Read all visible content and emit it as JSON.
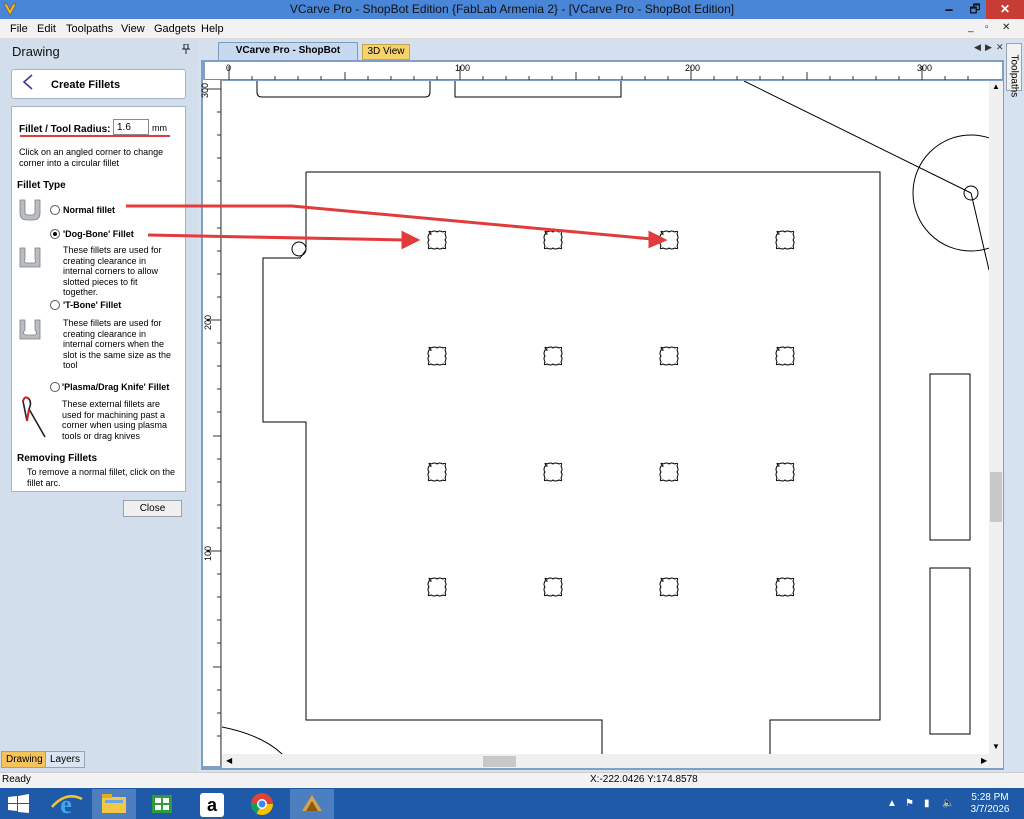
{
  "window": {
    "title": "VCarve Pro - ShopBot Edition {FabLab Armenia 2} - [VCarve Pro - ShopBot Edition]",
    "min_label": "🗕",
    "max_label": "🗗",
    "close_label": "✕"
  },
  "menu": {
    "items": [
      "File",
      "Edit",
      "Toolpaths",
      "View",
      "Gadgets",
      "Help"
    ],
    "mdi_controls": [
      "_",
      "▫",
      "✕"
    ]
  },
  "panel": {
    "title": "Drawing",
    "pin": "ᵖ",
    "form_title": "Create Fillets",
    "radius_label": "Fillet / Tool Radius:",
    "radius_value": "1.6",
    "radius_unit": "mm",
    "instructions": "Click on an angled corner to change corner into a circular fillet",
    "fillet_type_title": "Fillet Type",
    "options": [
      {
        "label": "Normal fillet",
        "desc": "",
        "checked": false
      },
      {
        "label": "'Dog-Bone' Fillet",
        "desc": "These fillets are used for creating clearance in internal corners to allow slotted pieces to fit together.",
        "checked": true
      },
      {
        "label": "'T-Bone' Fillet",
        "desc": "These fillets are used for creating clearance in internal corners when the slot is the same size as the tool",
        "checked": false
      },
      {
        "label": "'Plasma/Drag Knife' Fillet",
        "desc": "These external fillets are used for machining past a corner when using plasma tools or drag knives",
        "checked": false
      }
    ],
    "remove_title": "Removing Fillets",
    "remove_desc": "To remove a normal fillet, click on the fillet arc.",
    "close_label": "Close",
    "bottom_tabs": [
      "Drawing",
      "Layers"
    ]
  },
  "doc": {
    "tab_main": "VCarve Pro - ShopBot Edition",
    "tab_3d": "3D View",
    "nav": [
      "◀",
      "▶",
      "✕"
    ]
  },
  "right_tab": "Toolpaths",
  "rulers": {
    "h_labels": [
      "0",
      "100",
      "200",
      "300"
    ],
    "v_labels": [
      "300",
      "200",
      "100"
    ]
  },
  "status": {
    "left": "Ready",
    "coords": "X:-222.0426 Y:174.8578"
  },
  "taskbar": {
    "time": "5:28 PM",
    "date": "3/7/2026"
  },
  "colors": {
    "titlebar": "#4a86d8",
    "annotation_red": "#e23b3b",
    "taskbar": "#1e5aa8"
  }
}
